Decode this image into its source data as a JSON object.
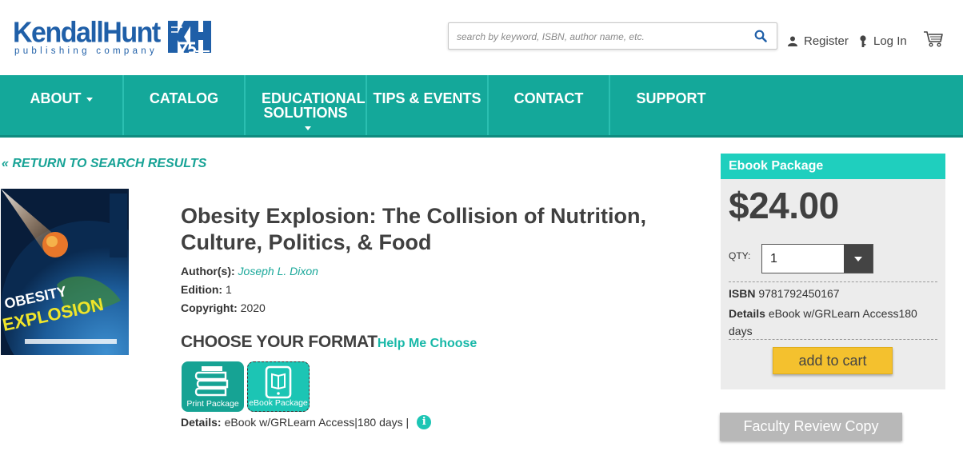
{
  "header": {
    "logo_word": "KendallHunt",
    "logo_sub": "publishing company",
    "search_placeholder": "search by keyword, ISBN, author name, etc.",
    "register_label": "Register",
    "login_label": "Log In"
  },
  "nav": {
    "items": [
      {
        "label": "ABOUT",
        "dropdown": true
      },
      {
        "label": "CATALOG",
        "dropdown": false
      },
      {
        "label": "EDUCATIONAL SOLUTIONS",
        "dropdown": true
      },
      {
        "label": "TIPS & EVENTS",
        "dropdown": false
      },
      {
        "label": "CONTACT",
        "dropdown": false
      },
      {
        "label": "SUPPORT",
        "dropdown": false
      }
    ]
  },
  "return_link": "« RETURN TO SEARCH RESULTS",
  "product": {
    "title": "Obesity Explosion: The Collision of Nutrition, Culture, Politics, & Food",
    "author_label": "Author(s):",
    "author": "Joseph L. Dixon",
    "edition_label": "Edition:",
    "edition": "1",
    "copyright_label": "Copyright:",
    "copyright": "2020",
    "choose_heading": "CHOOSE YOUR FORMAT",
    "help_link": "Help Me Choose",
    "formats": [
      {
        "label": "Print Package",
        "selected": false
      },
      {
        "label": "eBook Package",
        "selected": true
      }
    ],
    "details_label": "Details:",
    "details_value": "eBook w/GRLearn Access|180 days |"
  },
  "purchase_box": {
    "heading": "Ebook Package",
    "price": "$24.00",
    "qty_label": "QTY:",
    "qty_value": "1",
    "isbn_label": "ISBN",
    "isbn": "9781792450167",
    "details_label": "Details",
    "details": "eBook w/GRLearn Access180 days",
    "add_to_cart": "add to cart"
  },
  "faculty_button": "Faculty Review Copy",
  "colors": {
    "teal": "#14a89a",
    "teal_light": "#1fcfbe",
    "brand_blue": "#1f5fa8",
    "cart_yellow": "#f4c12e"
  }
}
